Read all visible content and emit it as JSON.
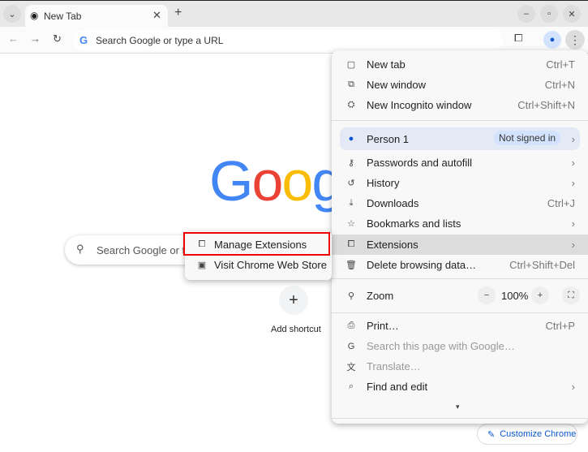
{
  "tab": {
    "title": "New Tab"
  },
  "omnibox": {
    "placeholder": "Search Google or type a URL"
  },
  "page": {
    "logo": "Google",
    "search_placeholder": "Search Google or type a URL",
    "search_visible": "Search Google or ty",
    "add_shortcut": "Add shortcut",
    "customize": "Customize Chrome"
  },
  "menu": {
    "items": [
      {
        "label": "New tab",
        "shortcut": "Ctrl+T",
        "icon": "new-tab-icon",
        "glyph": "▢"
      },
      {
        "label": "New window",
        "shortcut": "Ctrl+N",
        "icon": "new-window-icon",
        "glyph": "⧉"
      },
      {
        "label": "New Incognito window",
        "shortcut": "Ctrl+Shift+N",
        "icon": "incognito-icon",
        "glyph": "⛭"
      },
      {
        "label": "Passwords and autofill",
        "submenu": true,
        "icon": "key-icon",
        "glyph": "⚷"
      },
      {
        "label": "History",
        "submenu": true,
        "icon": "history-icon",
        "glyph": "↺"
      },
      {
        "label": "Downloads",
        "shortcut": "Ctrl+J",
        "icon": "download-icon",
        "glyph": "⤓"
      },
      {
        "label": "Bookmarks and lists",
        "submenu": true,
        "icon": "star-icon",
        "glyph": "☆"
      },
      {
        "label": "Extensions",
        "submenu": true,
        "icon": "puzzle-icon",
        "glyph": "⧠",
        "highlight": true
      },
      {
        "label": "Delete browsing data…",
        "shortcut": "Ctrl+Shift+Del",
        "icon": "trash-icon",
        "glyph": "🗑"
      },
      {
        "label": "Print…",
        "shortcut": "Ctrl+P",
        "icon": "print-icon",
        "glyph": "⎙"
      },
      {
        "label": "Search this page with Google…",
        "disabled": true,
        "icon": "google-icon",
        "glyph": "G"
      },
      {
        "label": "Translate…",
        "disabled": true,
        "icon": "translate-icon",
        "glyph": "文"
      },
      {
        "label": "Find and edit",
        "submenu": true,
        "icon": "find-icon",
        "glyph": "⌕"
      }
    ],
    "person": {
      "label": "Person 1",
      "status": "Not signed in"
    },
    "zoom": {
      "label": "Zoom",
      "value": "100%",
      "minus": "−",
      "plus": "+"
    }
  },
  "submenu": {
    "items": [
      {
        "label": "Manage Extensions",
        "icon": "puzzle-icon",
        "glyph": "⧠"
      },
      {
        "label": "Visit Chrome Web Store",
        "icon": "store-icon",
        "glyph": "▣"
      }
    ]
  }
}
